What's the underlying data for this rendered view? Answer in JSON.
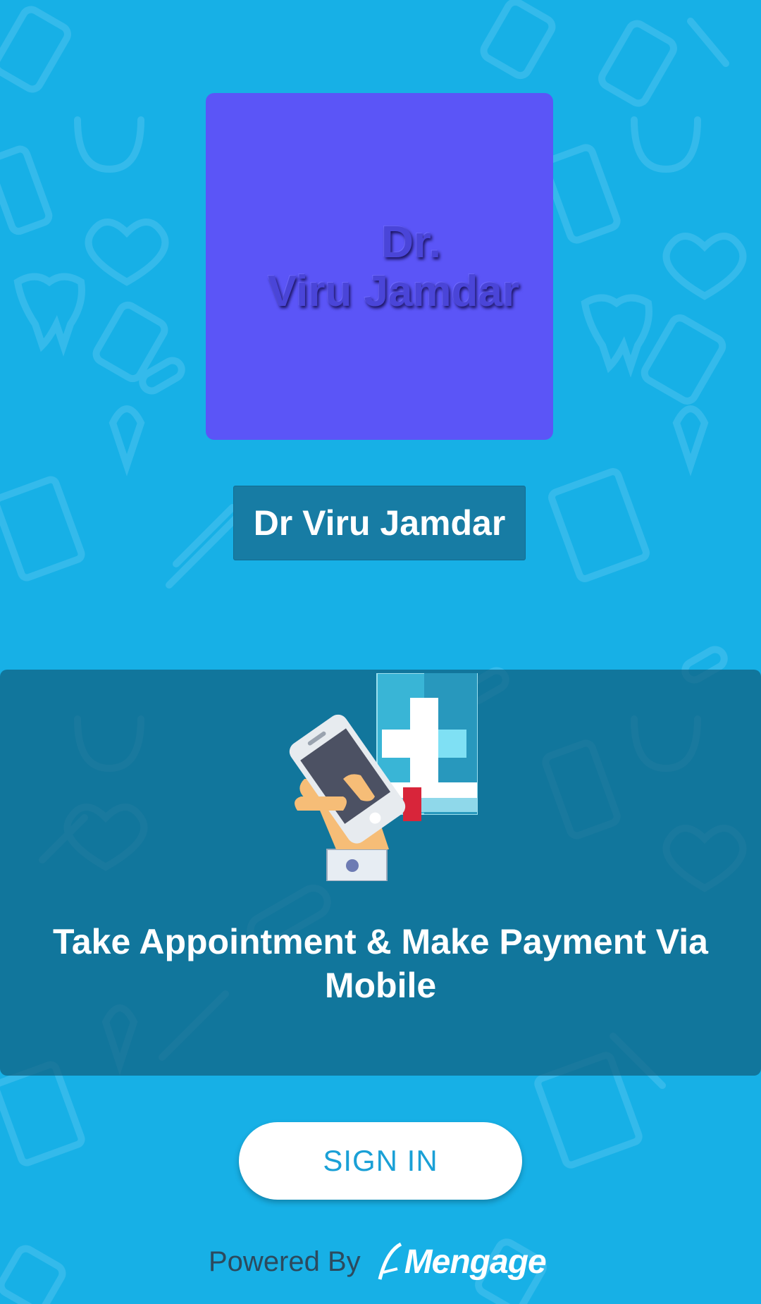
{
  "logo": {
    "line1": "Dr.",
    "line2": "Viru Jamdar"
  },
  "doctor": {
    "name": "Dr Viru Jamdar"
  },
  "promo": {
    "text": "Take Appointment & Make Payment Via Mobile"
  },
  "signin": {
    "label": "SIGN IN"
  },
  "footer": {
    "powered_by": "Powered By",
    "brand": "Mengage"
  },
  "colors": {
    "background": "#17b0e6",
    "logo_card": "#5b55f7",
    "name_plate": "#177ca4",
    "button_text": "#1aa0d6"
  },
  "icons": [
    "medical-pattern-background",
    "mobile-health-app-illustration",
    "mengage-logo"
  ]
}
